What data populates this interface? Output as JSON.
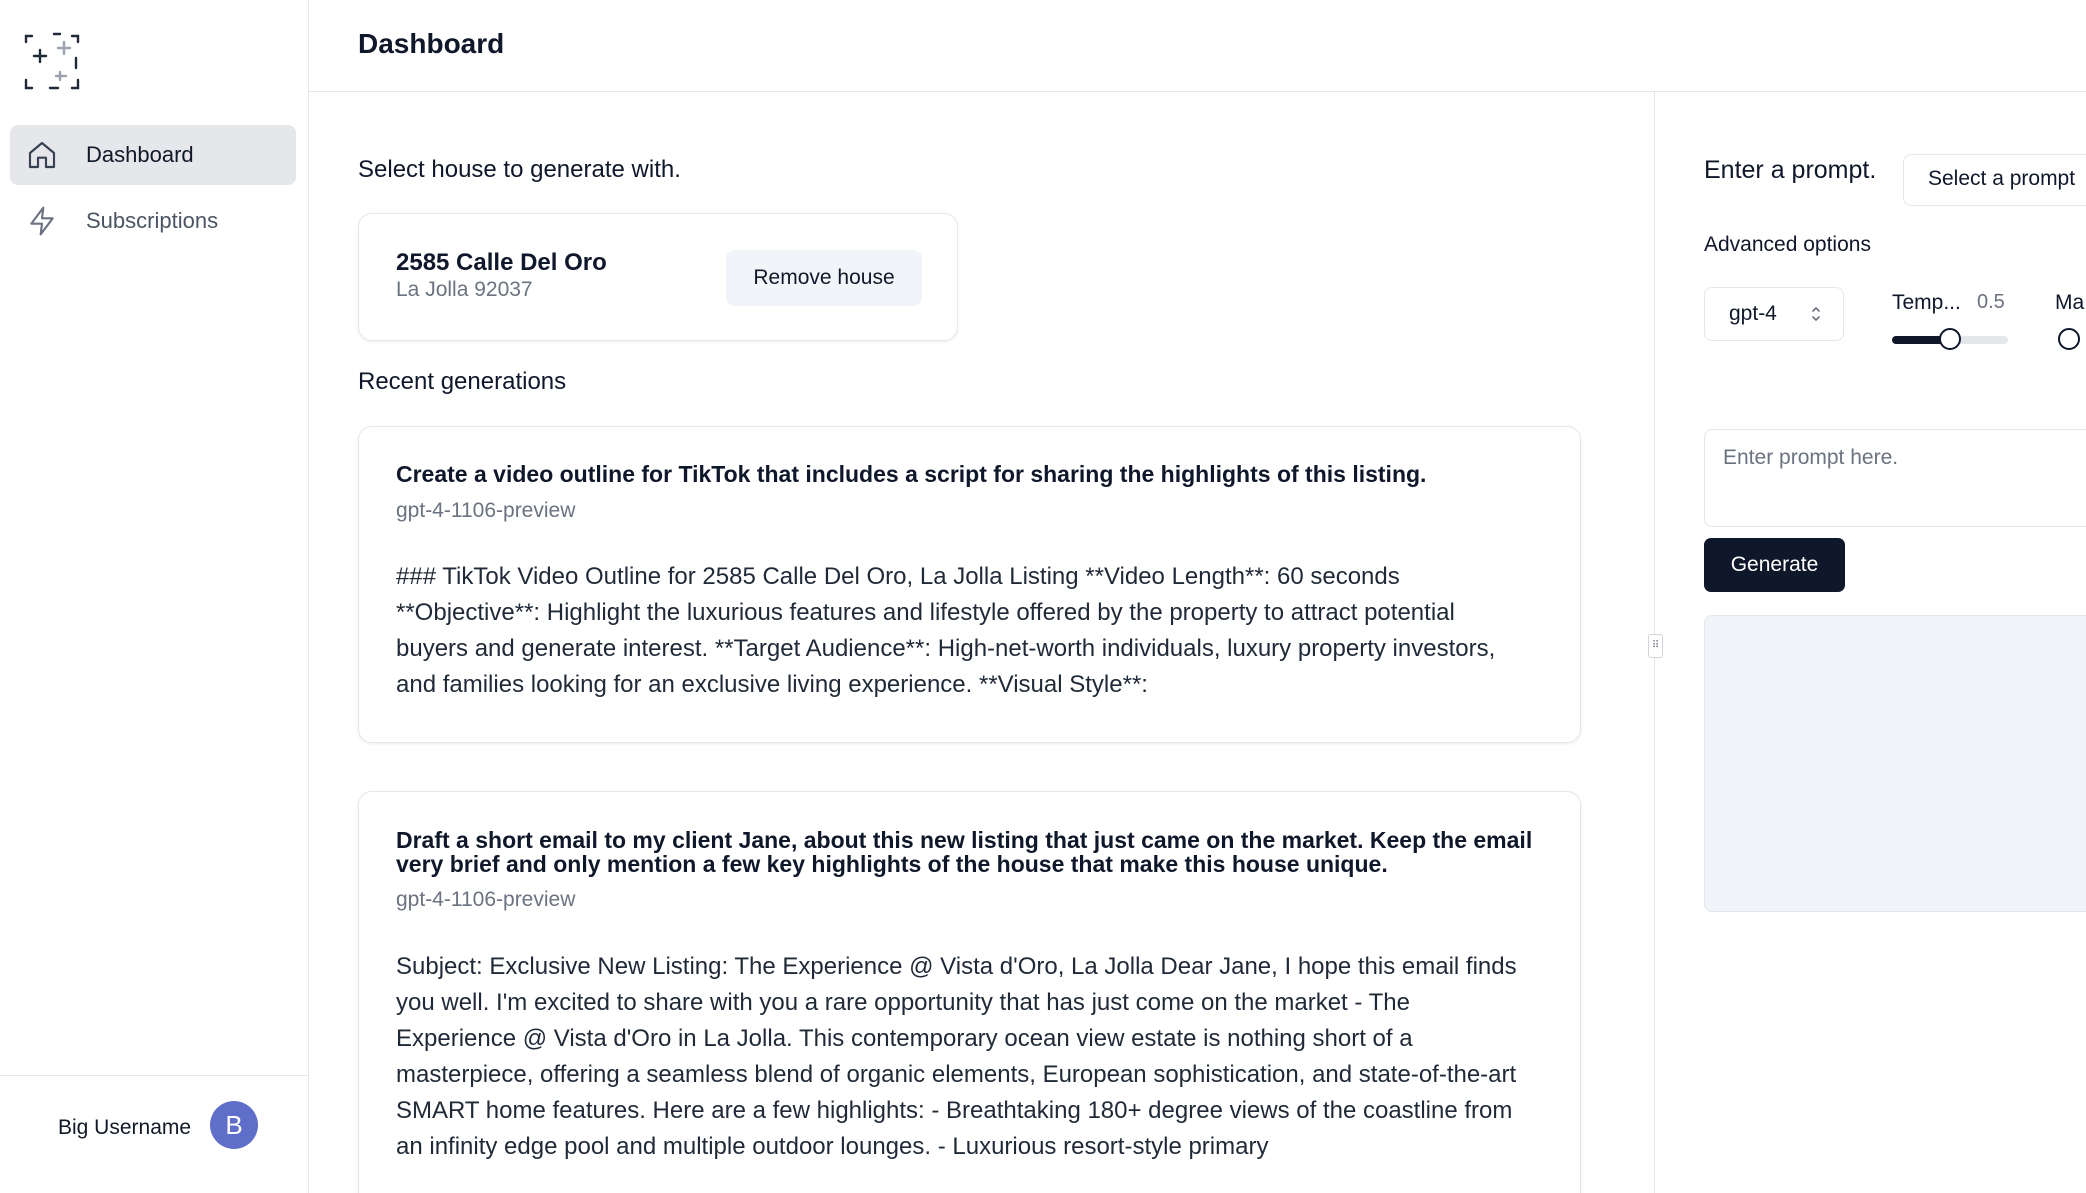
{
  "sidebar": {
    "logo_icon": "logo-icon",
    "items": [
      {
        "label": "Dashboard",
        "icon": "home-icon",
        "active": true
      },
      {
        "label": "Subscriptions",
        "icon": "lightning-icon",
        "active": false
      }
    ],
    "user": {
      "name": "Big Username",
      "avatar_initial": "B",
      "avatar_color": "#5f6fc9"
    }
  },
  "header": {
    "title": "Dashboard"
  },
  "main": {
    "select_house_label": "Select house to generate with.",
    "house": {
      "address": "2585 Calle Del Oro",
      "city": "La Jolla 92037",
      "remove_label": "Remove house"
    },
    "recent_label": "Recent generations",
    "generations": [
      {
        "prompt": "Create a video outline for TikTok that includes a script for sharing the highlights of this listing.",
        "model": "gpt-4-1106-preview",
        "body": "### TikTok Video Outline for 2585 Calle Del Oro, La Jolla Listing **Video Length**: 60 seconds **Objective**: Highlight the luxurious features and lifestyle offered by the property to attract potential buyers and generate interest. **Target Audience**: High-net-worth individuals, luxury property investors, and families looking for an exclusive living experience. **Visual Style**:"
      },
      {
        "prompt": "Draft a short email to my client Jane, about this new listing that just came on the market. Keep the email very brief and only mention a few key highlights of the house that make this house unique.",
        "model": "gpt-4-1106-preview",
        "body": "Subject: Exclusive New Listing: The Experience @ Vista d'Oro, La Jolla Dear Jane, I hope this email finds you well. I'm excited to share with you a rare opportunity that has just come on the market - The Experience @ Vista d'Oro in La Jolla. This contemporary ocean view estate is nothing short of a masterpiece, offering a seamless blend of organic elements, European sophistication, and state-of-the-art SMART home features. Here are a few highlights: - Breathtaking 180+ degree views of the coastline from an infinity edge pool and multiple outdoor lounges. - Luxurious resort-style primary"
      }
    ]
  },
  "right_panel": {
    "prompt_label": "Enter a prompt.",
    "prompt_select": "Select a prompt",
    "advanced_label": "Advanced options",
    "model_value": "gpt-4",
    "temperature": {
      "label": "Temp...",
      "value": "0.5",
      "fraction": 0.5
    },
    "max_label": "Ma",
    "prompt_placeholder": "Enter prompt here.",
    "generate_label": "Generate"
  },
  "colors": {
    "primary": "#0f172a",
    "muted": "#6b7280",
    "border": "#e5e7eb",
    "surface": "#f1f5f9"
  }
}
